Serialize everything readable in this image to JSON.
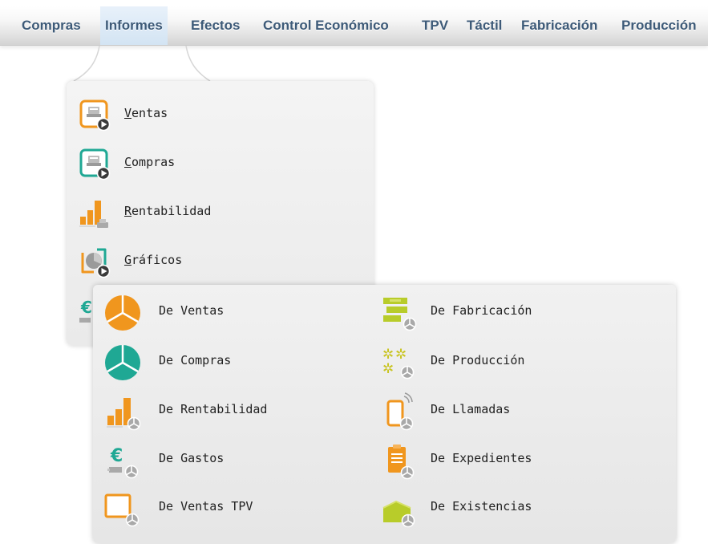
{
  "menubar": {
    "items": [
      {
        "label": "Compras"
      },
      {
        "label": "Informes",
        "active": true
      },
      {
        "label": "Efectos"
      },
      {
        "label": "Control Económico"
      },
      {
        "label": "TPV"
      },
      {
        "label": "Táctil"
      },
      {
        "label": "Fabricación"
      },
      {
        "label": "Producción"
      }
    ]
  },
  "informes_menu": {
    "items": [
      {
        "label": "Ventas",
        "icon": "sales-report-icon"
      },
      {
        "label": "Compras",
        "icon": "purchases-report-icon"
      },
      {
        "label": "Rentabilidad",
        "icon": "profitability-icon"
      },
      {
        "label": "Gráficos",
        "icon": "charts-icon"
      },
      {
        "label": "",
        "icon": "expenses-icon"
      }
    ]
  },
  "graficos_submenu": {
    "left": [
      {
        "label": "De Ventas",
        "icon": "sales-pie-icon"
      },
      {
        "label": "De Compras",
        "icon": "purchases-pie-icon"
      },
      {
        "label": "De Rentabilidad",
        "icon": "profitability-chart-icon"
      },
      {
        "label": "De Gastos",
        "icon": "expenses-chart-icon"
      },
      {
        "label": "De Ventas TPV",
        "icon": "pos-sales-chart-icon"
      }
    ],
    "right": [
      {
        "label": "De Fabricación",
        "icon": "manufacturing-chart-icon"
      },
      {
        "label": "De Producción",
        "icon": "production-chart-icon"
      },
      {
        "label": "De Llamadas",
        "icon": "calls-chart-icon"
      },
      {
        "label": "De Expedientes",
        "icon": "records-chart-icon"
      },
      {
        "label": "De Existencias",
        "icon": "stock-chart-icon"
      }
    ]
  },
  "colors": {
    "menu_text": "#3d5a78",
    "orange": "#f0961e",
    "teal": "#1fa894",
    "lime": "#b8cc2a",
    "gray_overlay": "#9a9a9a"
  }
}
